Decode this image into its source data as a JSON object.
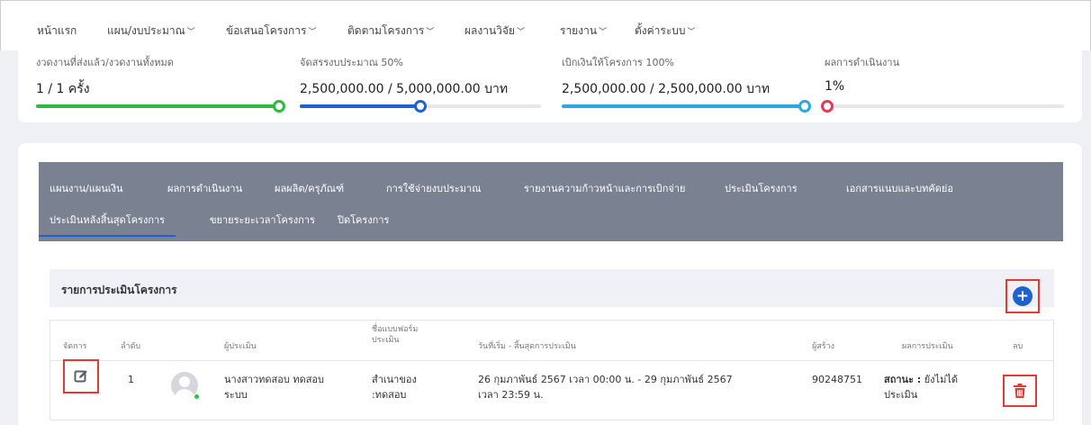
{
  "nav": {
    "items": [
      {
        "label": "หน้าแรก",
        "dropdown": false
      },
      {
        "label": "แผน/งบประมาณ",
        "dropdown": true
      },
      {
        "label": "ข้อเสนอโครงการ",
        "dropdown": true
      },
      {
        "label": "ติดตามโครงการ",
        "dropdown": true
      },
      {
        "label": "ผลงานวิจัย",
        "dropdown": true
      },
      {
        "label": "รายงาน",
        "dropdown": true
      },
      {
        "label": "ตั้งค่าระบบ",
        "dropdown": true
      }
    ]
  },
  "stats": [
    {
      "label": "งวดงานที่ส่งแล้ว/งวดงานทั้งหมด",
      "value": "1 / 1 ครั้ง",
      "progress": 1.0,
      "color": "#2dbb3f"
    },
    {
      "label": "จัดสรรงบประมาณ 50%",
      "value": "2,500,000.00 / 5,000,000.00 บาท",
      "progress": 0.5,
      "color": "#1e62d0"
    },
    {
      "label": "เบิกเงินให้โครงการ 100%",
      "value": "2,500,000.00 / 2,500,000.00 บาท",
      "progress": 1.0,
      "color": "#2aa9e0"
    },
    {
      "label": "ผลการดำเนินงาน",
      "value": "1%",
      "progress": 0.01,
      "color": "#e53958"
    }
  ],
  "tabs": [
    "แผนงาน/แผนเงิน",
    "ผลการดำเนินงาน",
    "ผลผลิต/ครุภัณฑ์",
    "การใช้จ่ายงบประมาณ",
    "รายงานความก้าวหน้าและการเบิกจ่าย",
    "ประเมินโครงการ",
    "เอกสารแนบและบทคัดย่อ",
    "ประเมินหลังสิ้นสุดโครงการ",
    "ขยายระยะเวลาโครงการ",
    "ปิดโครงการ"
  ],
  "active_tab": "ประเมินหลังสิ้นสุดโครงการ",
  "list": {
    "title": "รายการประเมินโครงการ",
    "add_icon": "plus-circle-icon"
  },
  "table": {
    "headers": {
      "manage": "จัดการ",
      "order": "ลำดับ",
      "evaluator": "ผู้ประเมิน",
      "form_name": "ชื่อแบบฟอร์ม\nประเมิน",
      "period": "วันที่เริ่ม - สิ้นสุดการประเมิน",
      "creator": "ผู้สร้าง",
      "result": "ผลการประเมิน",
      "delete": "ลบ"
    },
    "rows": [
      {
        "order": "1",
        "evaluator": "นางสาวทดสอบ ทดสอบ\nระบบ",
        "form_name": "สำเนาของ\n:ทดสอบ",
        "period": "26 กุมภาพันธ์ 2567 เวลา 00:00 น. - 29 กุมภาพันธ์ 2567\nเวลา 23:59 น.",
        "creator": "90248751",
        "result_label": "สถานะ :",
        "result_value": " ยังไม่ได้\nประเมิน"
      }
    ]
  },
  "colors": {
    "accent": "#1e62d0",
    "danger": "#e53935",
    "tabbar": "#7a8190"
  }
}
